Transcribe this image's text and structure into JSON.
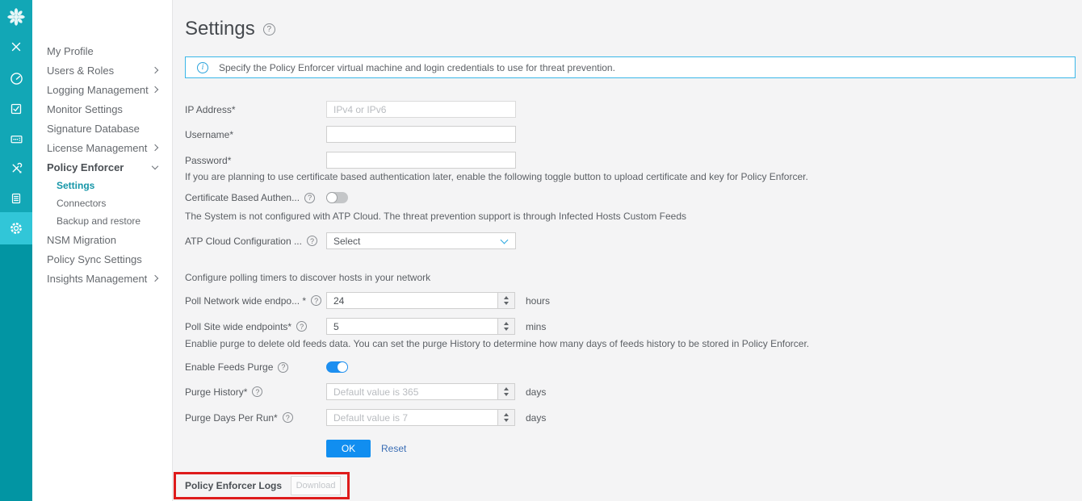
{
  "colors": {
    "rail_teal_top": "#12A7B6",
    "rail_teal_bottom": "#0295A3",
    "rail_highlight": "#31C6D8",
    "selected_nav_teal": "#1596A8",
    "banner_border_blue": "#3AB7E8",
    "primary_button_blue": "#118EF0",
    "toggle_on_blue": "#1D8FF0",
    "annotation_red": "#DE1B1B"
  },
  "icons": {
    "help_glyph": "?",
    "info_glyph": "i"
  },
  "rail": {
    "icons": [
      "juniper-logo",
      "close",
      "dashboard",
      "tasks",
      "console",
      "tools",
      "reports",
      "settings-gear"
    ],
    "active": "settings-gear"
  },
  "sidebar": {
    "items": [
      {
        "label": "My Profile"
      },
      {
        "label": "Users & Roles",
        "expandable": true
      },
      {
        "label": "Logging Management",
        "expandable": true
      },
      {
        "label": "Monitor Settings"
      },
      {
        "label": "Signature Database"
      },
      {
        "label": "License Management",
        "expandable": true
      },
      {
        "label": "Policy Enforcer",
        "expandable": true,
        "expanded": true
      },
      {
        "label": "Settings",
        "sub": true,
        "selected": true
      },
      {
        "label": "Connectors",
        "sub": true
      },
      {
        "label": "Backup and restore",
        "sub": true
      },
      {
        "label": "NSM Migration"
      },
      {
        "label": "Policy Sync Settings"
      },
      {
        "label": "Insights Management",
        "expandable": true
      }
    ]
  },
  "header": {
    "title": "Settings"
  },
  "banner": {
    "text": "Specify the Policy Enforcer virtual machine and login credentials to use for threat prevention."
  },
  "form": {
    "ip": {
      "label": "IP Address*",
      "placeholder": "IPv4 or IPv6",
      "value": ""
    },
    "username": {
      "label": "Username*",
      "value": ""
    },
    "password": {
      "label": "Password*",
      "value": ""
    },
    "cert_note": "If you are planning to use certificate based authentication later, enable the following toggle button to upload certificate and key for Policy Enforcer.",
    "cert": {
      "label": "Certificate Based Authen...",
      "toggle_state": "off"
    },
    "atp_note": "The System is not configured with ATP Cloud. The threat prevention support is through Infected Hosts Custom Feeds",
    "atp": {
      "label": "ATP Cloud Configuration ...",
      "selected_option": "Select"
    },
    "polling_note": "Configure polling timers to discover hosts in your network",
    "poll_network": {
      "label": "Poll Network wide endpo... *",
      "value": "24",
      "unit": "hours"
    },
    "poll_site": {
      "label": "Poll Site wide endpoints*",
      "value": "5",
      "unit": "mins"
    },
    "purge_note": "Enablie purge to delete old feeds data. You can set the purge History to determine how many days of feeds history to be stored in Policy Enforcer.",
    "feeds_purge": {
      "label": "Enable Feeds Purge",
      "toggle_state": "on"
    },
    "purge_history": {
      "label": "Purge History*",
      "placeholder": "Default value is 365",
      "value": "",
      "unit": "days"
    },
    "purge_days": {
      "label": "Purge Days Per Run*",
      "placeholder": "Default value is 7",
      "value": "",
      "unit": "days"
    },
    "actions": {
      "ok": "OK",
      "reset": "Reset"
    }
  },
  "logs": {
    "label": "Policy Enforcer Logs",
    "download": "Download"
  }
}
